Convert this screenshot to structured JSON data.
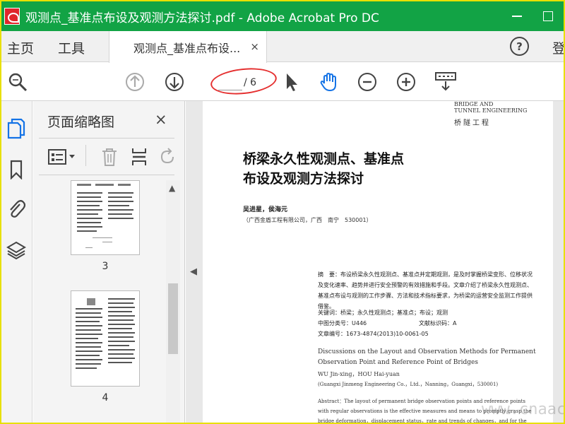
{
  "window": {
    "title": "观测点_基准点布设及观测方法探讨.pdf - Adobe Acrobat Pro DC"
  },
  "tabs": {
    "home": "主页",
    "tools": "工具",
    "doc": "观测点_基准点布设...",
    "close": "×",
    "help": "?",
    "signin": "登"
  },
  "toolbar": {
    "page_current": "",
    "page_total": "/ 6"
  },
  "thumbnails": {
    "title": "页面缩略图",
    "close": "×",
    "pages": [
      {
        "label": "3"
      },
      {
        "label": "4"
      }
    ]
  },
  "document": {
    "logo_en_1": "BRIDGE AND",
    "logo_en_2": "TUNNEL ENGINEERING",
    "logo_cn": "桥隧工程",
    "title_line1": "桥梁永久性观测点、基准点",
    "title_line2": "布设及观测方法探讨",
    "authors": "吴进星，侯海元",
    "affiliation": "（广西金盾工程有限公司，广西　南宁　530001）",
    "abstract_cn": "摘　要：布设桥梁永久性观测点、基准点并定期观测，是及时掌握桥梁变形、位移状况及变化速率、趋势并进行安全预警的有效措施和手段。文章介绍了桥梁永久性观测点、基准点布设与观测的工作步骤、方法和技术指标要求，为桥梁的运营安全监测工作提供借鉴。",
    "keywords": "关键词：桥梁；永久性观测点；基准点；布设；观测",
    "clc": "中图分类号：U446",
    "doc_code": "文献标识码：A",
    "article_no": "文章编号：1673-4874(2013)10-0061-05",
    "en_title": "Discussions on the Layout and Observation Methods for Permanent Observation Point and Reference Point of Bridges",
    "en_authors": "WU Jin-xing，HOU Hai-yuan",
    "en_affil": "(Guangxi Jinmeng Engineering Co.，Ltd.，Nanning，Guangxi，530001)",
    "en_abstract": "Abstract：The layout of permanent bridge observation points and reference points with regular observations is the effective measures and means to promptly grasp the bridge deformation，displacement status，rate and trends of changes，and for the early safety warning. This"
  },
  "watermark": {
    "bottom_right": "www.cnaac.com"
  },
  "colors": {
    "titlebar": "#12a345",
    "frame": "#e8e000",
    "annotation": "#e53030",
    "hand_tool": "#1473e6"
  }
}
